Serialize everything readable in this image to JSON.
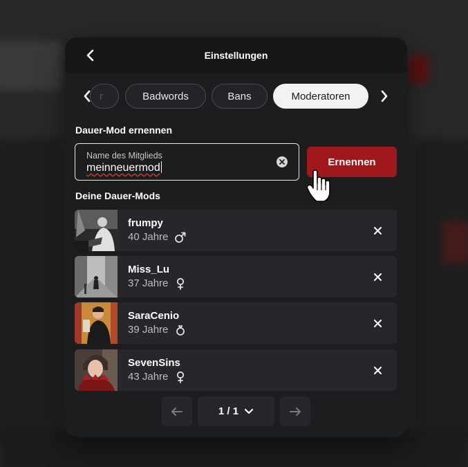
{
  "header": {
    "title": "Einstellungen"
  },
  "tabs": [
    {
      "label": "r",
      "partial": true
    },
    {
      "label": "Badwords"
    },
    {
      "label": "Bans"
    },
    {
      "label": "Moderatoren",
      "active": true
    }
  ],
  "appoint": {
    "section_title": "Dauer-Mod ernennen",
    "field_label": "Name des Mitglieds",
    "field_value": "meinneuermod",
    "button_label": "Ernennen"
  },
  "mods": {
    "section_title": "Deine Dauer-Mods",
    "items": [
      {
        "name": "frumpy",
        "age": "40 Jahre",
        "gender": "male"
      },
      {
        "name": "Miss_Lu",
        "age": "37 Jahre",
        "gender": "female"
      },
      {
        "name": "SaraCenio",
        "age": "39 Jahre",
        "gender": "ring"
      },
      {
        "name": "SevenSins",
        "age": "43 Jahre",
        "gender": "female"
      }
    ]
  },
  "pagination": {
    "page": "1 / 1"
  },
  "colors": {
    "accent": "#a0181b",
    "modal_bg": "#1c1d1f",
    "row_bg": "#26272a"
  }
}
